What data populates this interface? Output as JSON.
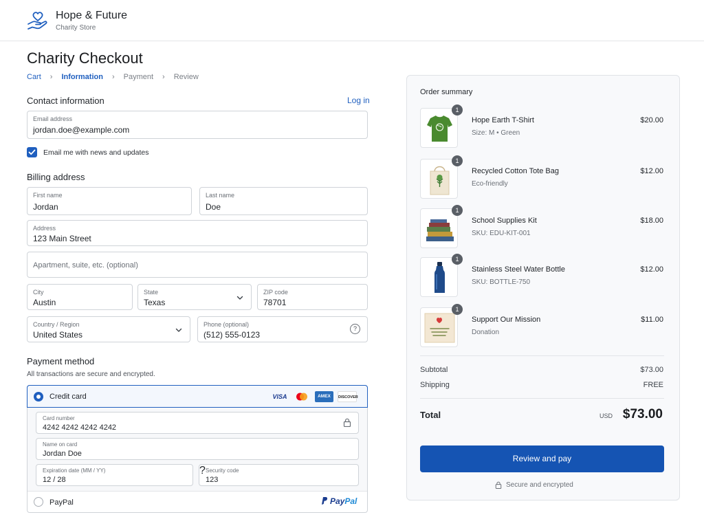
{
  "brand": {
    "name": "Hope & Future",
    "subtitle": "Charity Store",
    "logo_icon": "heart-hand-icon"
  },
  "page": {
    "title": "Charity Checkout"
  },
  "breadcrumb": [
    {
      "label": "Cart",
      "state": "link"
    },
    {
      "label": "Information",
      "state": "active"
    },
    {
      "label": "Payment",
      "state": "inactive"
    },
    {
      "label": "Review",
      "state": "inactive"
    }
  ],
  "contact": {
    "heading": "Contact information",
    "login_label": "Log in",
    "email": {
      "label": "Email address",
      "value": "jordan.doe@example.com"
    },
    "newsletter": {
      "label": "Email me with news and updates",
      "checked": true
    }
  },
  "billing": {
    "heading": "Billing address",
    "first_name": {
      "label": "First name",
      "value": "Jordan"
    },
    "last_name": {
      "label": "Last name",
      "value": "Doe"
    },
    "address": {
      "label": "Address",
      "value": "123 Main Street"
    },
    "apartment": {
      "placeholder": "Apartment, suite, etc. (optional)"
    },
    "city": {
      "label": "City",
      "value": "Austin"
    },
    "state": {
      "label": "State",
      "value": "Texas"
    },
    "zip": {
      "label": "ZIP code",
      "value": "78701"
    },
    "country": {
      "label": "Country / Region",
      "value": "United States"
    },
    "phone": {
      "label": "Phone (optional)",
      "value": "(512) 555-0123",
      "help": "?"
    }
  },
  "payment": {
    "heading": "Payment method",
    "subtitle": "All transactions are secure and encrypted.",
    "credit_card": {
      "label": "Credit card",
      "selected": true,
      "brands": {
        "visa": "VISA",
        "amex": "AMEX",
        "discover": "DISCOVER"
      },
      "card_number": {
        "label": "Card number",
        "value": "4242 4242 4242 4242"
      },
      "name_on_card": {
        "label": "Name on card",
        "value": "Jordan Doe"
      },
      "expiration": {
        "label": "Expiration date (MM / YY)",
        "value": "12 / 28"
      },
      "security_code": {
        "label": "Security code",
        "value": "123",
        "help": "?"
      }
    },
    "paypal": {
      "label": "PayPal",
      "selected": false,
      "logo_pay": "Pay",
      "logo_pal": "Pal"
    }
  },
  "summary": {
    "title": "Order summary",
    "items": [
      {
        "name": "Hope Earth T-Shirt",
        "detail": "Size: M  •  Green",
        "price": "$20.00",
        "qty": "1",
        "thumb_icon": "tshirt-icon"
      },
      {
        "name": "Recycled Cotton Tote Bag",
        "detail": "Eco-friendly",
        "price": "$12.00",
        "qty": "1",
        "thumb_icon": "tote-bag-icon"
      },
      {
        "name": "School Supplies Kit",
        "detail": "SKU: EDU-KIT-001",
        "price": "$18.00",
        "qty": "1",
        "thumb_icon": "books-icon"
      },
      {
        "name": "Stainless Steel Water Bottle",
        "detail": "SKU: BOTTLE-750",
        "price": "$12.00",
        "qty": "1",
        "thumb_icon": "bottle-icon"
      },
      {
        "name": "Support Our Mission",
        "detail": "Donation",
        "price": "$11.00",
        "qty": "1",
        "thumb_icon": "thank-you-card-icon"
      }
    ],
    "subtotal": {
      "label": "Subtotal",
      "value": "$73.00"
    },
    "shipping": {
      "label": "Shipping",
      "value": "FREE"
    },
    "total": {
      "label": "Total",
      "currency": "USD",
      "value": "$73.00"
    },
    "pay_button": "Review and pay",
    "secure_note": "Secure and encrypted"
  },
  "colors": {
    "accent": "#1554b3",
    "link": "#1f5fbf"
  }
}
